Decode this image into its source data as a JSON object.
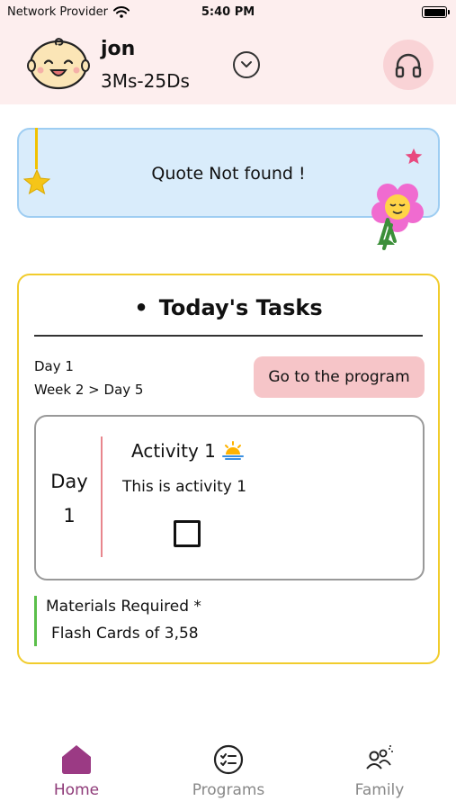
{
  "status_bar": {
    "carrier": "Network Provider",
    "time": "5:40 PM"
  },
  "header": {
    "child_name": "jon",
    "child_age": "3Ms-25Ds",
    "avatar_icon": "baby-face-icon",
    "dropdown_icon": "chevron-down-icon",
    "support_icon": "headphones-icon"
  },
  "quote": {
    "text": "Quote Not found !"
  },
  "tasks": {
    "title": "Today's Tasks",
    "day_label": "Day 1",
    "week_label": "Week 2 > Day 5",
    "program_button": "Go to the program",
    "activity": {
      "day_word": "Day",
      "day_number": "1",
      "title": "Activity 1",
      "description": "This is activity 1",
      "completed": false
    },
    "materials": {
      "title": "Materials Required *",
      "item": "Flash Cards of 3,58"
    }
  },
  "nav": {
    "items": [
      {
        "label": "Home",
        "icon": "home-icon",
        "active": true
      },
      {
        "label": "Programs",
        "icon": "checklist-icon",
        "active": false
      },
      {
        "label": "Family",
        "icon": "family-icon",
        "active": false
      }
    ]
  },
  "colors": {
    "header_bg": "#fdeeee",
    "quote_bg": "#d9ecfb",
    "quote_border": "#9ecdf2",
    "tasks_border": "#f1cc2c",
    "program_button_bg": "#f6c5c8",
    "day_divider": "#e8868d",
    "materials_bar": "#5bbf4a",
    "nav_active": "#8e3a78",
    "nav_inactive": "#888888"
  }
}
